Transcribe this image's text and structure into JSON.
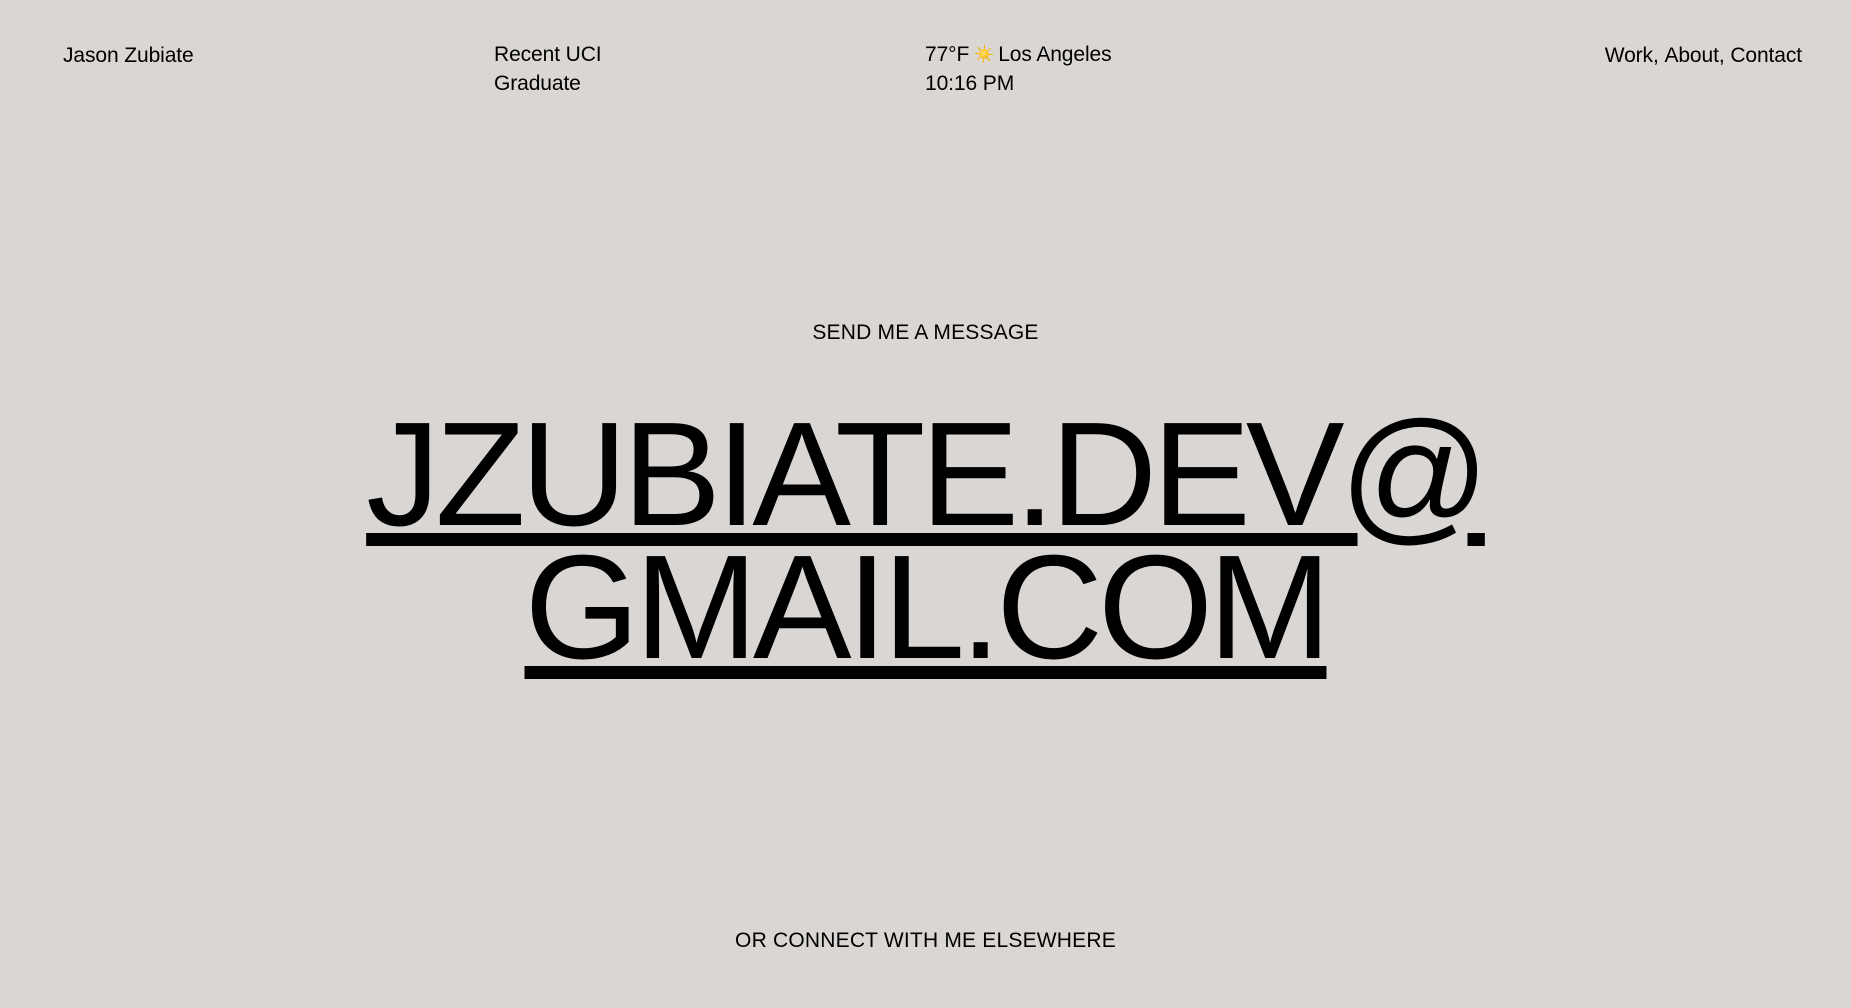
{
  "header": {
    "brand": "Jason Zubiate",
    "tagline": "Recent UCI Graduate",
    "weather": {
      "temperature": "77°F",
      "icon": "sun-icon",
      "city": "Los Angeles",
      "time": "10:16 PM"
    },
    "nav": {
      "items": [
        "Work",
        "About",
        "Contact"
      ],
      "separator": ", "
    }
  },
  "main": {
    "message_label": "SEND ME A MESSAGE",
    "email_line1": "JZUBIATE.DEV@",
    "email_line2": "GMAIL.COM",
    "connect_label": "OR CONNECT WITH ME ELSEWHERE"
  },
  "colors": {
    "background": "#d9d6d3",
    "text": "#000000",
    "sun": "#f5b400"
  }
}
